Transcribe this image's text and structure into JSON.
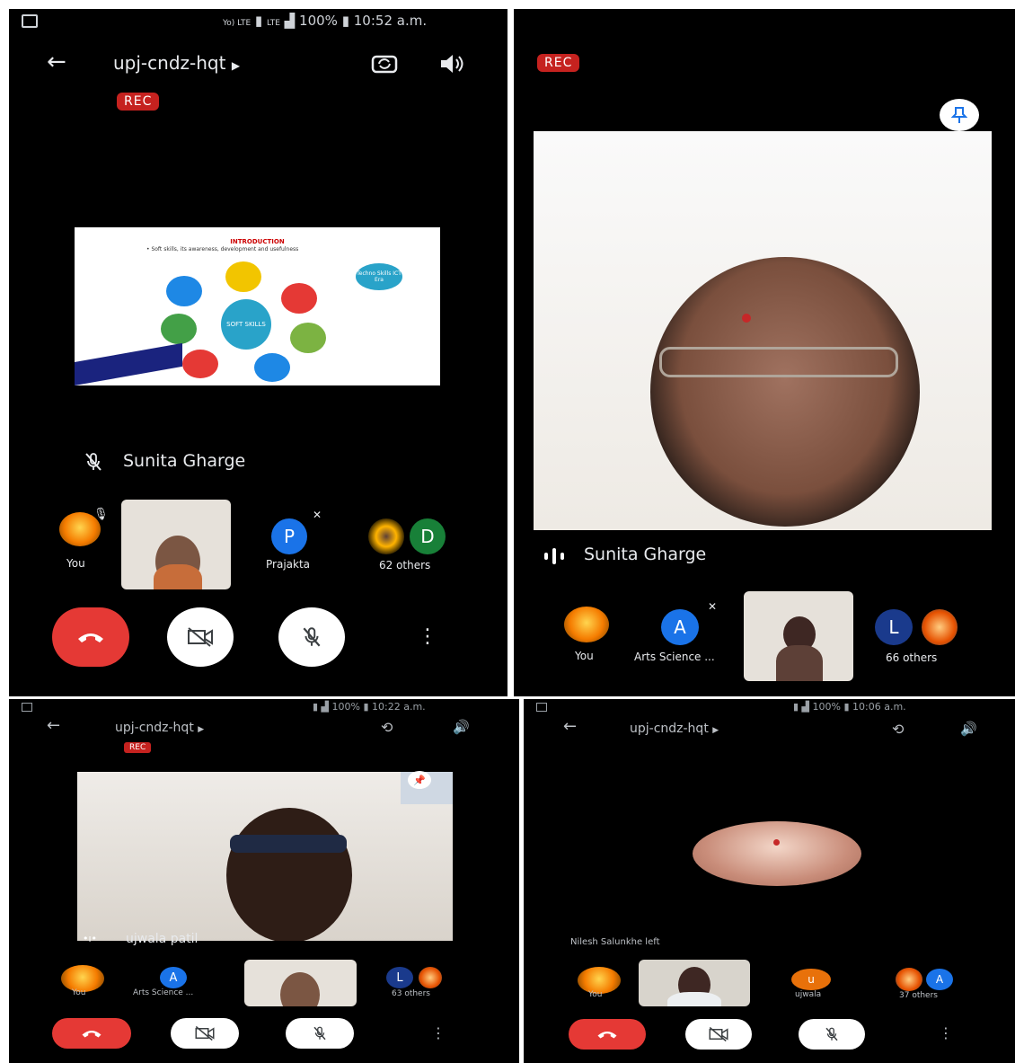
{
  "panel1": {
    "status": {
      "net1": "Yo) LTE",
      "net2": "LTE",
      "battery": "100%",
      "time": "10:52 a.m."
    },
    "meeting_code": "upj-cndz-hqt",
    "rec": "REC",
    "slide": {
      "heading": "INTRODUCTION",
      "bullet": "• Soft skills, its awareness, development and usefulness",
      "center": "SOFT SKILLS",
      "side": "Techno Skills ICT Era"
    },
    "speaker": "Sunita Gharge",
    "participants": {
      "you": "You",
      "p_initial": "P",
      "p_name": "Prajakta",
      "d_initial": "D",
      "others": "62 others"
    }
  },
  "panel2": {
    "rec": "REC",
    "speaker": "Sunita Gharge",
    "participants": {
      "you": "You",
      "a_initial": "A",
      "a_name": "Arts Science ...",
      "l_initial": "L",
      "others": "66 others"
    }
  },
  "panel3": {
    "status": {
      "battery": "100%",
      "time": "10:22 a.m."
    },
    "meeting_code": "upj-cndz-hqt",
    "rec": "REC",
    "speaker": "ujwala patil",
    "participants": {
      "you": "You",
      "a_initial": "A",
      "a_name": "Arts Science ...",
      "l_initial": "L",
      "others": "63 others"
    }
  },
  "panel4": {
    "status": {
      "battery": "100%",
      "time": "10:06 a.m."
    },
    "meeting_code": "upj-cndz-hqt",
    "notice": "Nilesh Salunkhe left",
    "participants": {
      "you": "You",
      "u_initial": "u",
      "u_name": "ujwala",
      "a_initial": "A",
      "others": "37 others"
    }
  },
  "colors": {
    "rec": "#c5221f",
    "end_call": "#e53935",
    "avatar_blue": "#1a73e8",
    "avatar_green": "#188038",
    "avatar_navy": "#1a3a8c",
    "avatar_orange": "#e8710a"
  }
}
